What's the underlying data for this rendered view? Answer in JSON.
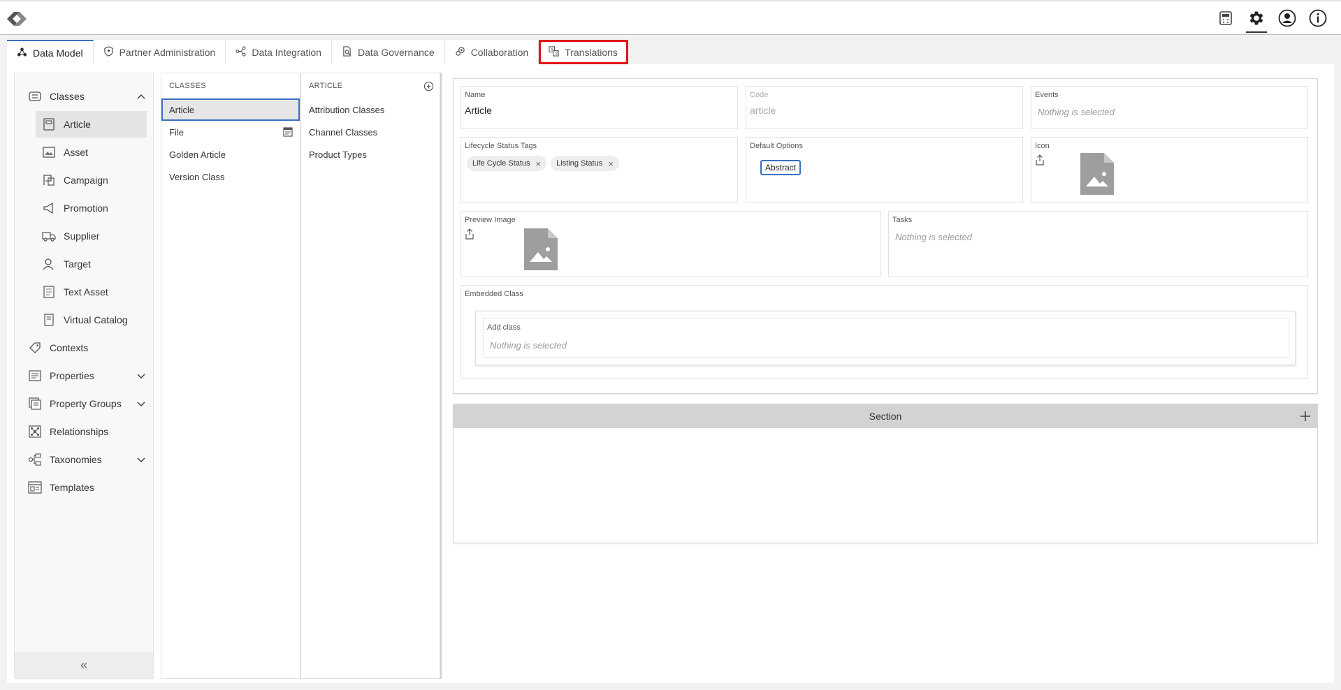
{
  "header": {
    "icons": [
      "calculator-icon",
      "gear-icon",
      "user-icon",
      "info-icon"
    ]
  },
  "tabs": [
    {
      "label": "Data Model",
      "icon": "data-model-icon",
      "active": true
    },
    {
      "label": "Partner Administration",
      "icon": "shield-icon"
    },
    {
      "label": "Data Integration",
      "icon": "integration-icon"
    },
    {
      "label": "Data Governance",
      "icon": "governance-icon"
    },
    {
      "label": "Collaboration",
      "icon": "collaboration-icon"
    },
    {
      "label": "Translations",
      "icon": "translate-icon",
      "highlighted": true
    }
  ],
  "sidebar": {
    "items": [
      {
        "label": "Classes",
        "icon": "classes-icon",
        "expanded": true
      },
      {
        "label": "Article",
        "icon": "article-icon",
        "selected": true
      },
      {
        "label": "Asset",
        "icon": "image-icon"
      },
      {
        "label": "Campaign",
        "icon": "campaign-icon"
      },
      {
        "label": "Promotion",
        "icon": "megaphone-icon"
      },
      {
        "label": "Supplier",
        "icon": "truck-icon"
      },
      {
        "label": "Target",
        "icon": "target-user-icon"
      },
      {
        "label": "Text Asset",
        "icon": "text-file-icon"
      },
      {
        "label": "Virtual Catalog",
        "icon": "catalog-icon"
      },
      {
        "label": "Contexts",
        "icon": "tag-icon"
      },
      {
        "label": "Properties",
        "icon": "properties-icon"
      },
      {
        "label": "Property Groups",
        "icon": "property-groups-icon"
      },
      {
        "label": "Relationships",
        "icon": "relationships-icon"
      },
      {
        "label": "Taxonomies",
        "icon": "taxonomy-icon"
      },
      {
        "label": "Templates",
        "icon": "templates-icon"
      }
    ],
    "collapse_label": "«"
  },
  "classes_column": {
    "header": "CLASSES",
    "items": [
      "Article",
      "File",
      "Golden Article",
      "Version Class"
    ]
  },
  "article_column": {
    "header": "ARTICLE",
    "items": [
      "Attribution Classes",
      "Channel Classes",
      "Product Types"
    ]
  },
  "form": {
    "name_label": "Name",
    "name_value": "Article",
    "code_label": "Code",
    "code_value": "article",
    "events_label": "Events",
    "events_value": "Nothing is selected",
    "lifecycle_label": "Lifecycle Status Tags",
    "lifecycle_tags": [
      "Life Cycle Status",
      "Listing Status"
    ],
    "tag_remove": "×",
    "default_options_label": "Default Options",
    "default_option": "Abstract",
    "icon_label": "Icon",
    "preview_label": "Preview Image",
    "tasks_label": "Tasks",
    "tasks_value": "Nothing is selected",
    "embedded_label": "Embedded Class",
    "add_class_label": "Add class",
    "add_class_value": "Nothing is selected"
  },
  "section": {
    "title": "Section"
  }
}
